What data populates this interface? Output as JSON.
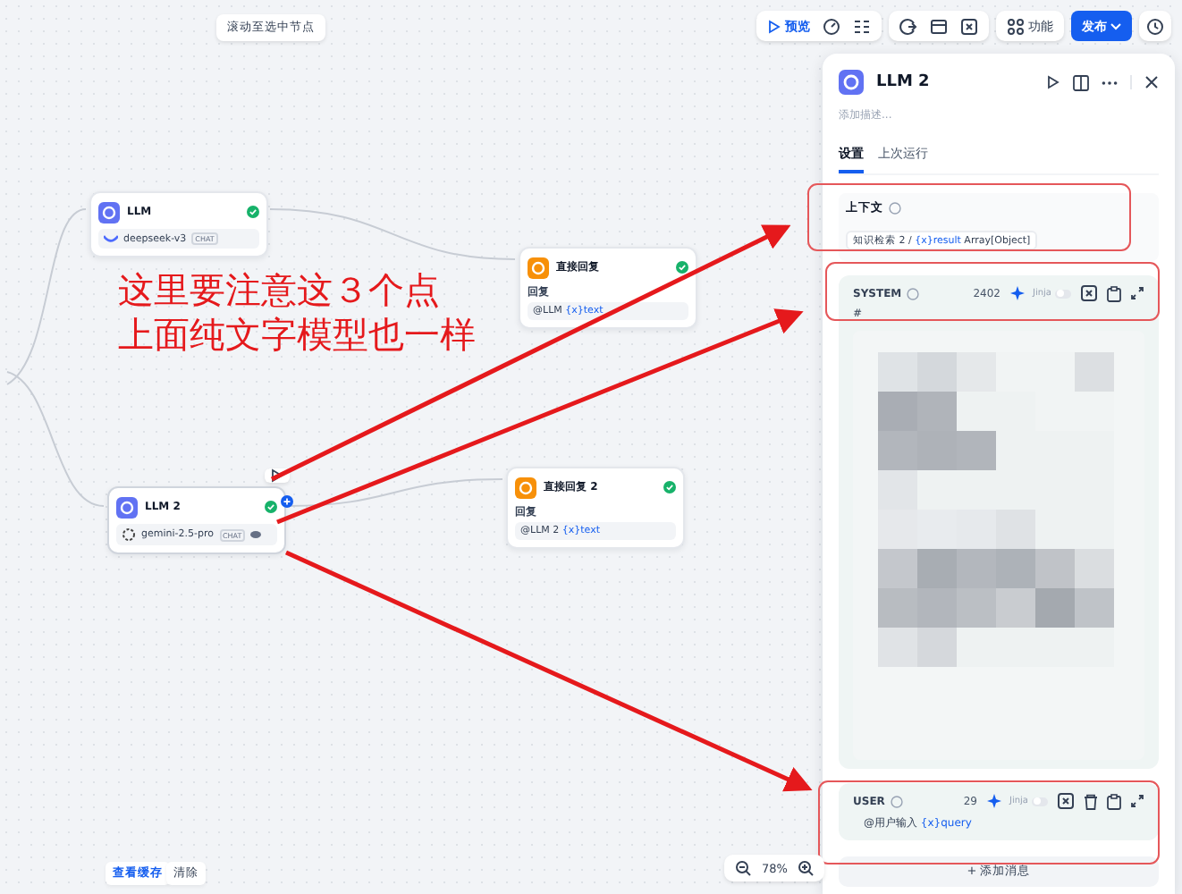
{
  "toolbar": {
    "scroll_hint": "滚动至选中节点",
    "preview": "预览",
    "features": "功能",
    "publish": "发布"
  },
  "nodes": [
    {
      "kind": "llm",
      "title": "LLM",
      "model": "deepseek-v3",
      "badge": "CHAT",
      "selected": false
    },
    {
      "kind": "answer",
      "title": "直接回复",
      "field_label": "回复",
      "ref_node": "@LLM",
      "ref_var": "{x}text"
    },
    {
      "kind": "llm",
      "title": "LLM 2",
      "model": "gemini-2.5-pro",
      "badge": "CHAT",
      "selected": true
    },
    {
      "kind": "answer",
      "title": "直接回复 2",
      "field_label": "回复",
      "ref_node": "@LLM 2",
      "ref_var": "{x}text"
    }
  ],
  "annotation": {
    "lines": [
      "这里要注意这３个点",
      "上面纯文字模型也一样"
    ]
  },
  "panel": {
    "title": "LLM 2",
    "description_placeholder": "添加描述...",
    "tabs": [
      {
        "label": "设置",
        "selected": true
      },
      {
        "label": "上次运行",
        "selected": false
      }
    ],
    "context": {
      "label": "上下文",
      "source": "知识检索 2 /",
      "var": "{x}result",
      "type": "Array[Object]"
    },
    "prompts": [
      {
        "role": "SYSTEM",
        "count": "2402",
        "jinja": "Jinja",
        "jinja_on": false,
        "text": "#",
        "blurred": true
      },
      {
        "role": "USER",
        "count": "29",
        "jinja": "Jinja",
        "jinja_on": false,
        "ref_node": "@用户输入",
        "ref_var": "{x}query",
        "blurred": false
      }
    ],
    "add_message": "+ 添加消息"
  },
  "footer": {
    "view_cache": "查看缓存",
    "clear": "清除",
    "zoom": "78%"
  }
}
